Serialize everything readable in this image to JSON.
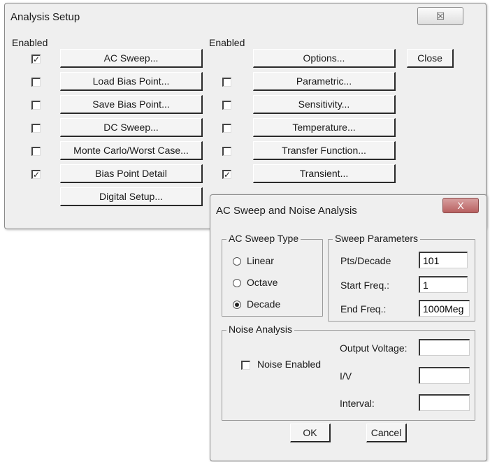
{
  "analysis": {
    "title": "Analysis Setup",
    "close_glyph": "☒",
    "enabled_header": "Enabled",
    "enabled_header_2": "Enabled",
    "close_label": "Close",
    "left": [
      {
        "label": "AC Sweep...",
        "checked": true
      },
      {
        "label": "Load Bias Point...",
        "checked": false
      },
      {
        "label": "Save Bias Point...",
        "checked": false
      },
      {
        "label": "DC Sweep...",
        "checked": false
      },
      {
        "label": "Monte Carlo/Worst Case...",
        "checked": false
      },
      {
        "label": "Bias Point Detail",
        "checked": true
      },
      {
        "label": "Digital Setup...",
        "checkbox": false
      }
    ],
    "right": [
      {
        "label": "Options...",
        "checkbox": false
      },
      {
        "label": "Parametric...",
        "checked": false
      },
      {
        "label": "Sensitivity...",
        "checked": false
      },
      {
        "label": "Temperature...",
        "checked": false
      },
      {
        "label": "Transfer Function...",
        "checked": false
      },
      {
        "label": "Transient...",
        "checked": true
      }
    ]
  },
  "acsweep": {
    "title": "AC Sweep and Noise Analysis",
    "close_glyph": "X",
    "sweep_type": {
      "label": "AC Sweep Type",
      "options": [
        "Linear",
        "Octave",
        "Decade"
      ],
      "selected": "Decade"
    },
    "params": {
      "label": "Sweep Parameters",
      "pts_label": "Pts/Decade",
      "pts_value": "101",
      "start_label": "Start Freq.:",
      "start_value": "1",
      "end_label": "End Freq.:",
      "end_value": "1000Meg"
    },
    "noise": {
      "label": "Noise Analysis",
      "enabled_label": "Noise Enabled",
      "enabled": false,
      "output_label": "Output Voltage:",
      "output_value": "",
      "iv_label": "I/V",
      "iv_value": "",
      "interval_label": "Interval:",
      "interval_value": ""
    },
    "ok_label": "OK",
    "cancel_label": "Cancel"
  }
}
